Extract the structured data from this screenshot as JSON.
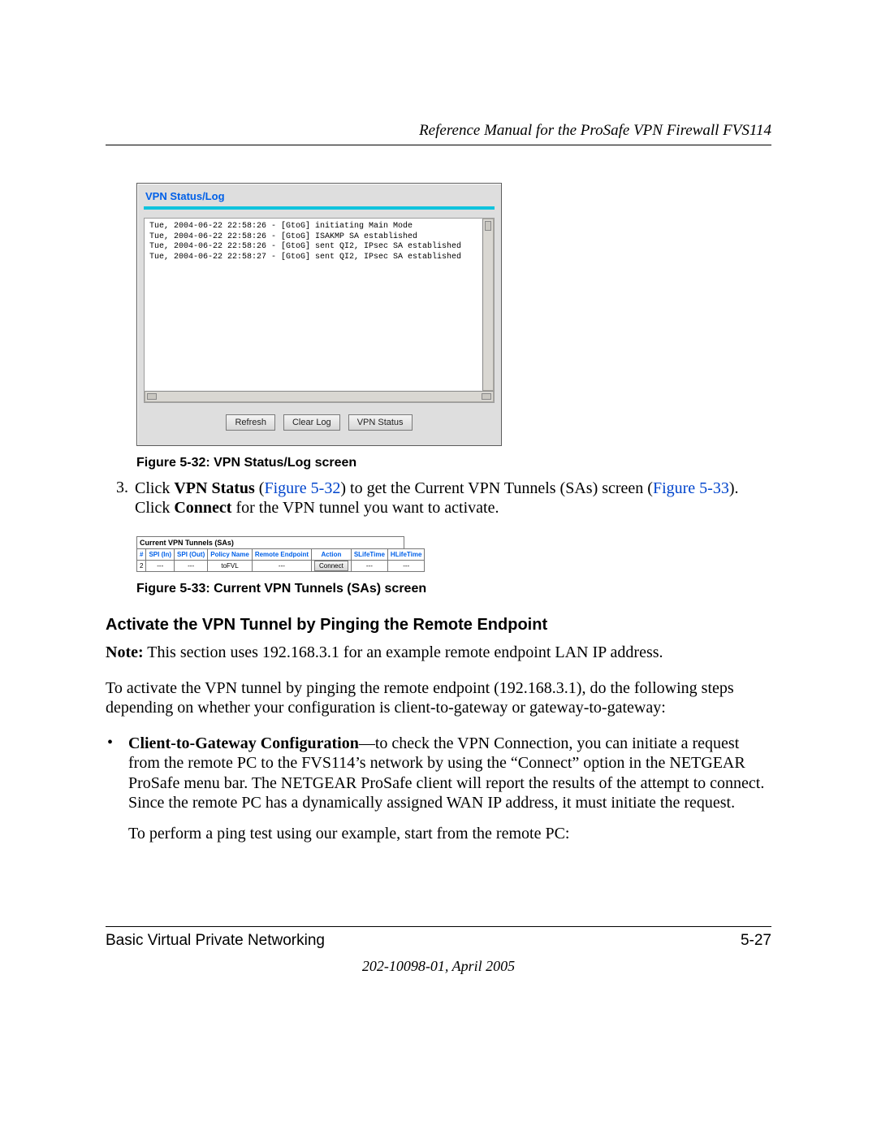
{
  "header": {
    "running_title": "Reference Manual for the ProSafe VPN Firewall FVS114"
  },
  "vpn_panel": {
    "title": "VPN Status/Log",
    "log_lines": [
      "Tue, 2004-06-22 22:58:26 - [GtoG] initiating Main Mode",
      "Tue, 2004-06-22 22:58:26 - [GtoG] ISAKMP SA established",
      "Tue, 2004-06-22 22:58:26 - [GtoG] sent QI2, IPsec SA established",
      "Tue, 2004-06-22 22:58:27 - [GtoG] sent QI2, IPsec SA established"
    ],
    "buttons": {
      "refresh": "Refresh",
      "clear": "Clear Log",
      "status": "VPN Status"
    }
  },
  "figure32_caption": "Figure 5-32:  VPN Status/Log screen",
  "step3": {
    "num": "3.",
    "pre": "Click ",
    "bold1": "VPN Status",
    "mid1": " (",
    "link1": "Figure 5-32",
    "mid2": ") to get the Current VPN Tunnels (SAs) screen (",
    "link2": "Figure 5-33",
    "mid3": "). Click ",
    "bold2": "Connect",
    "post": " for the VPN tunnel you want to activate."
  },
  "tunnels": {
    "title": "Current VPN Tunnels (SAs)",
    "headers": [
      "#",
      "SPI (In)",
      "SPI (Out)",
      "Policy Name",
      "Remote Endpoint",
      "Action",
      "SLifeTime",
      "HLifeTime"
    ],
    "row": {
      "num": "2",
      "spi_in": "---",
      "spi_out": "---",
      "policy": "toFVL",
      "remote": "---",
      "action_btn": "Connect",
      "slife": "---",
      "hlife": "---"
    }
  },
  "figure33_caption": "Figure 5-33:  Current VPN Tunnels (SAs) screen",
  "heading": "Activate the VPN Tunnel by Pinging the Remote Endpoint",
  "note": {
    "bold": "Note:",
    "text": " This section uses 192.168.3.1 for an example remote endpoint LAN IP address."
  },
  "para_activate": "To activate the VPN tunnel by pinging the remote endpoint (192.168.3.1), do the following steps depending on whether your configuration is client-to-gateway or gateway-to-gateway:",
  "bullet1": {
    "bold": "Client-to-Gateway Configuration",
    "text": "—to check the VPN Connection, you can initiate a request from the remote PC to the FVS114’s network by using the “Connect” option in the NETGEAR ProSafe menu bar. The NETGEAR ProSafe client will report the results of the attempt to connect. Since the remote PC has a dynamically assigned WAN IP address, it must initiate the request."
  },
  "subpara": "To perform a ping test using our example, start from the remote PC:",
  "footer": {
    "section": "Basic Virtual Private Networking",
    "page": "5-27",
    "date": "202-10098-01, April 2005"
  }
}
